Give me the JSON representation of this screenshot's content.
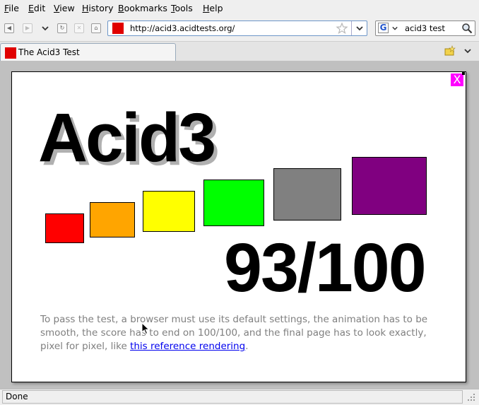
{
  "menu": {
    "file": "File",
    "edit": "Edit",
    "view": "View",
    "history": "History",
    "bookmarks": "Bookmarks",
    "tools": "Tools",
    "help": "Help"
  },
  "nav": {
    "url": "http://acid3.acidtests.org/",
    "search_value": "acid3 test",
    "search_engine_letter": "G"
  },
  "tab": {
    "title": "The Acid3 Test"
  },
  "page": {
    "close_label": "X",
    "heading": "Acid3",
    "score": "93/100",
    "notice_text": "To pass the test, a browser must use its default settings, the animation has to be smooth, the score has to end on 100/100, and the final page has to look exactly, pixel for pixel, like ",
    "notice_link": "this reference rendering",
    "notice_end": ".",
    "box_colors": [
      "#ff0000",
      "#ffa500",
      "#ffff00",
      "#00ff00",
      "#808080",
      "#800080"
    ]
  },
  "status": {
    "text": "Done"
  }
}
